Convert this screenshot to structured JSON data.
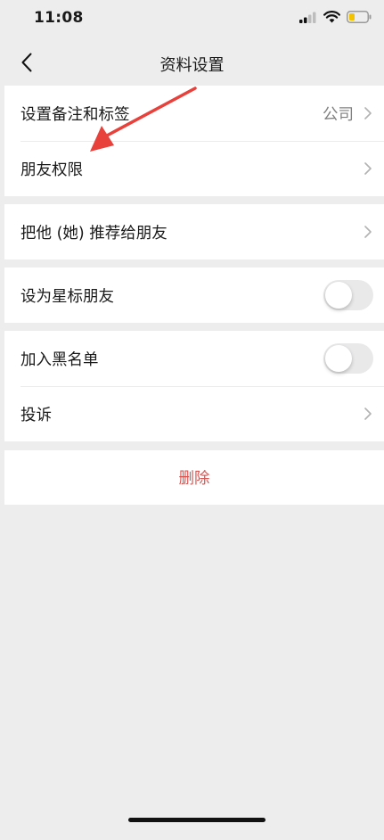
{
  "status_bar": {
    "time": "11:08"
  },
  "nav": {
    "title": "资料设置"
  },
  "groups": [
    {
      "rows": [
        {
          "label": "设置备注和标签",
          "value": "公司"
        },
        {
          "label": "朋友权限"
        }
      ]
    },
    {
      "rows": [
        {
          "label": "把他 (她) 推荐给朋友"
        }
      ]
    },
    {
      "rows": [
        {
          "label": "设为星标朋友",
          "toggle_on": false
        }
      ]
    },
    {
      "rows": [
        {
          "label": "加入黑名单",
          "toggle_on": false
        },
        {
          "label": "投诉"
        }
      ]
    }
  ],
  "delete_label": "删除",
  "colors": {
    "background": "#ededed",
    "delete": "#d9534f",
    "annotation_arrow": "#e8403a"
  },
  "icons": [
    "back-chevron-icon",
    "chevron-right-icon",
    "signal-icon",
    "wifi-icon",
    "battery-icon"
  ]
}
